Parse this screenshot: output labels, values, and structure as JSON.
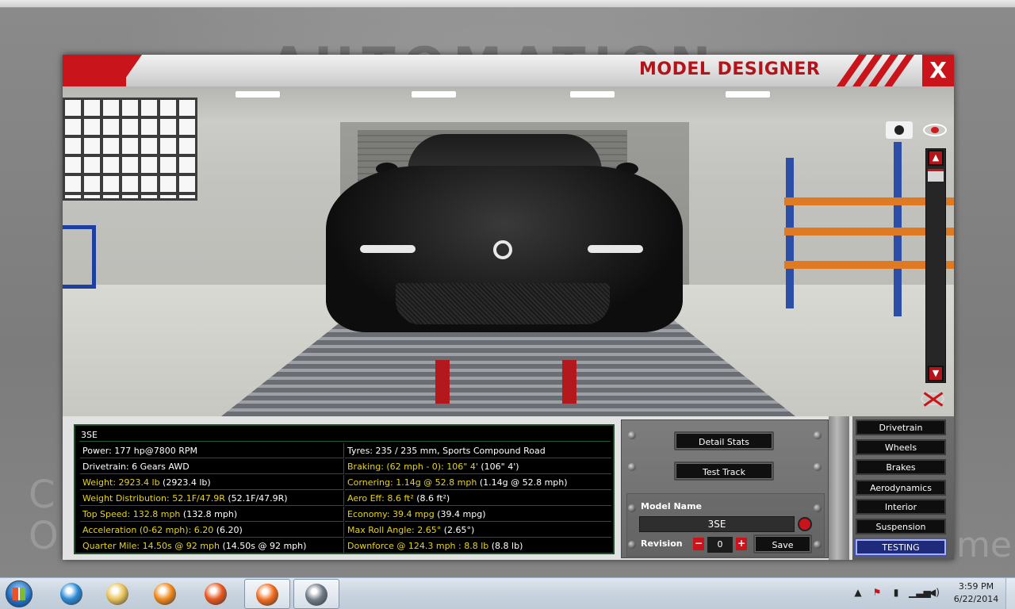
{
  "app": {
    "modal_title": "MODEL DESIGNER",
    "close_label": "X",
    "background_logo": "AUTOMATION",
    "background_left_text": "C\nO",
    "background_right_text": "me"
  },
  "viewport": {
    "controls": {
      "camera_icon": "camera-icon",
      "visibility_icon": "eye-icon",
      "zoom_up_icon": "chevron-up-icon",
      "zoom_down_icon": "chevron-down-icon",
      "hide_view_icon": "eye-crossed-icon"
    }
  },
  "stats": {
    "model_code": "3SE",
    "left": [
      {
        "label": "Power: 177 hp@7800 RPM",
        "value": "",
        "highlight": false
      },
      {
        "label": "Drivetrain: 6 Gears AWD",
        "value": "",
        "highlight": false
      },
      {
        "label": "Weight: 2923.4 lb",
        "value": " (2923.4 lb)",
        "highlight": true
      },
      {
        "label": "Weight Distribution: 52.1F/47.9R",
        "value": " (52.1F/47.9R)",
        "highlight": true
      },
      {
        "label": "Top Speed: 132.8 mph",
        "value": " (132.8 mph)",
        "highlight": true
      },
      {
        "label": "Acceleration (0-62 mph): 6.20",
        "value": " (6.20)",
        "highlight": true
      },
      {
        "label": "Quarter Mile: 14.50s @ 92 mph",
        "value": " (14.50s @ 92 mph)",
        "highlight": true
      }
    ],
    "right": [
      {
        "label": "Tyres: 235 / 235 mm, Sports Compound Road",
        "value": "",
        "highlight": false
      },
      {
        "label": "Braking: (62 mph - 0): 106\" 4'",
        "value": " (106\" 4')",
        "highlight": true
      },
      {
        "label": "Cornering: 1.14g @ 52.8 mph",
        "value": " (1.14g @ 52.8 mph)",
        "highlight": true
      },
      {
        "label": "Aero Eff: 8.6 ft²",
        "value": " (8.6 ft²)",
        "highlight": true
      },
      {
        "label": "Economy: 39.4 mpg",
        "value": " (39.4 mpg)",
        "highlight": true
      },
      {
        "label": "Max Roll Angle: 2.65°",
        "value": " (2.65°)",
        "highlight": true
      },
      {
        "label": "Downforce @ 124.3 mph : 8.8 lb",
        "value": " (8.8 lb)",
        "highlight": true
      }
    ]
  },
  "controls": {
    "detail_stats_label": "Detail Stats",
    "test_track_label": "Test Track",
    "model_name_label": "Model Name",
    "model_name_value": "3SE",
    "revision_label": "Revision",
    "revision_minus": "−",
    "revision_value": "0",
    "revision_plus": "+",
    "save_label": "Save"
  },
  "nav": {
    "items": [
      {
        "label": "Drivetrain",
        "active": false
      },
      {
        "label": "Wheels",
        "active": false
      },
      {
        "label": "Brakes",
        "active": false
      },
      {
        "label": "Aerodynamics",
        "active": false
      },
      {
        "label": "Interior",
        "active": false
      },
      {
        "label": "Suspension",
        "active": false
      },
      {
        "label": "TESTING",
        "active": true
      }
    ]
  },
  "taskbar": {
    "start_icon": "windows-start-icon",
    "apps": [
      {
        "name": "internet-explorer-icon",
        "color": "#2b8ad6",
        "active": false
      },
      {
        "name": "file-explorer-icon",
        "color": "#e8c35a",
        "active": false
      },
      {
        "name": "media-player-icon",
        "color": "#f08a1c",
        "active": false
      },
      {
        "name": "firefox-icon",
        "color": "#e8581f",
        "active": false
      },
      {
        "name": "origin-icon",
        "color": "#f26b1d",
        "active": true
      },
      {
        "name": "automation-game-icon",
        "color": "#6f7a85",
        "active": true
      }
    ],
    "tray": {
      "show_hidden_icon": "chevron-up-icon",
      "action_center_icon": "flag-red-x-icon",
      "power_icon": "battery-icon",
      "network_icon": "signal-bars-icon",
      "volume_icon": "speaker-icon"
    },
    "clock": {
      "time": "3:59 PM",
      "date": "6/22/2014"
    }
  }
}
